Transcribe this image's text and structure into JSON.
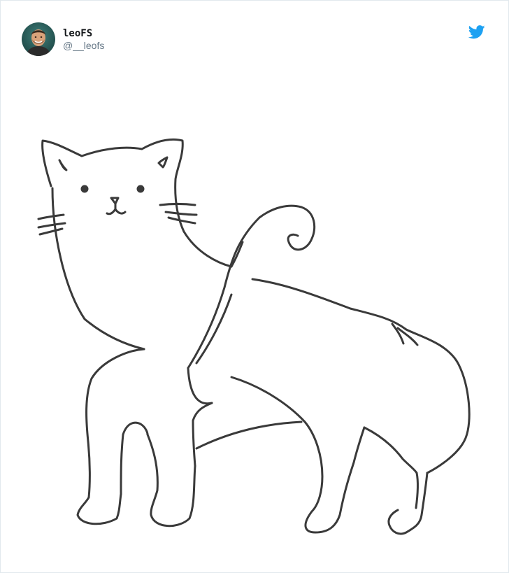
{
  "tweet": {
    "author": {
      "display_name": "leoFS",
      "handle": "@__leofs",
      "avatar": "profile-photo"
    },
    "icons": {
      "platform": "twitter-bird-icon"
    },
    "media": {
      "kind": "pencil-sketch-of-cat"
    }
  },
  "colors": {
    "twitter_blue": "#1da1f2",
    "name_text": "#14171a",
    "handle_text": "#657786",
    "border": "#e1e8ed",
    "sketch_stroke": "#3a3a3a"
  }
}
